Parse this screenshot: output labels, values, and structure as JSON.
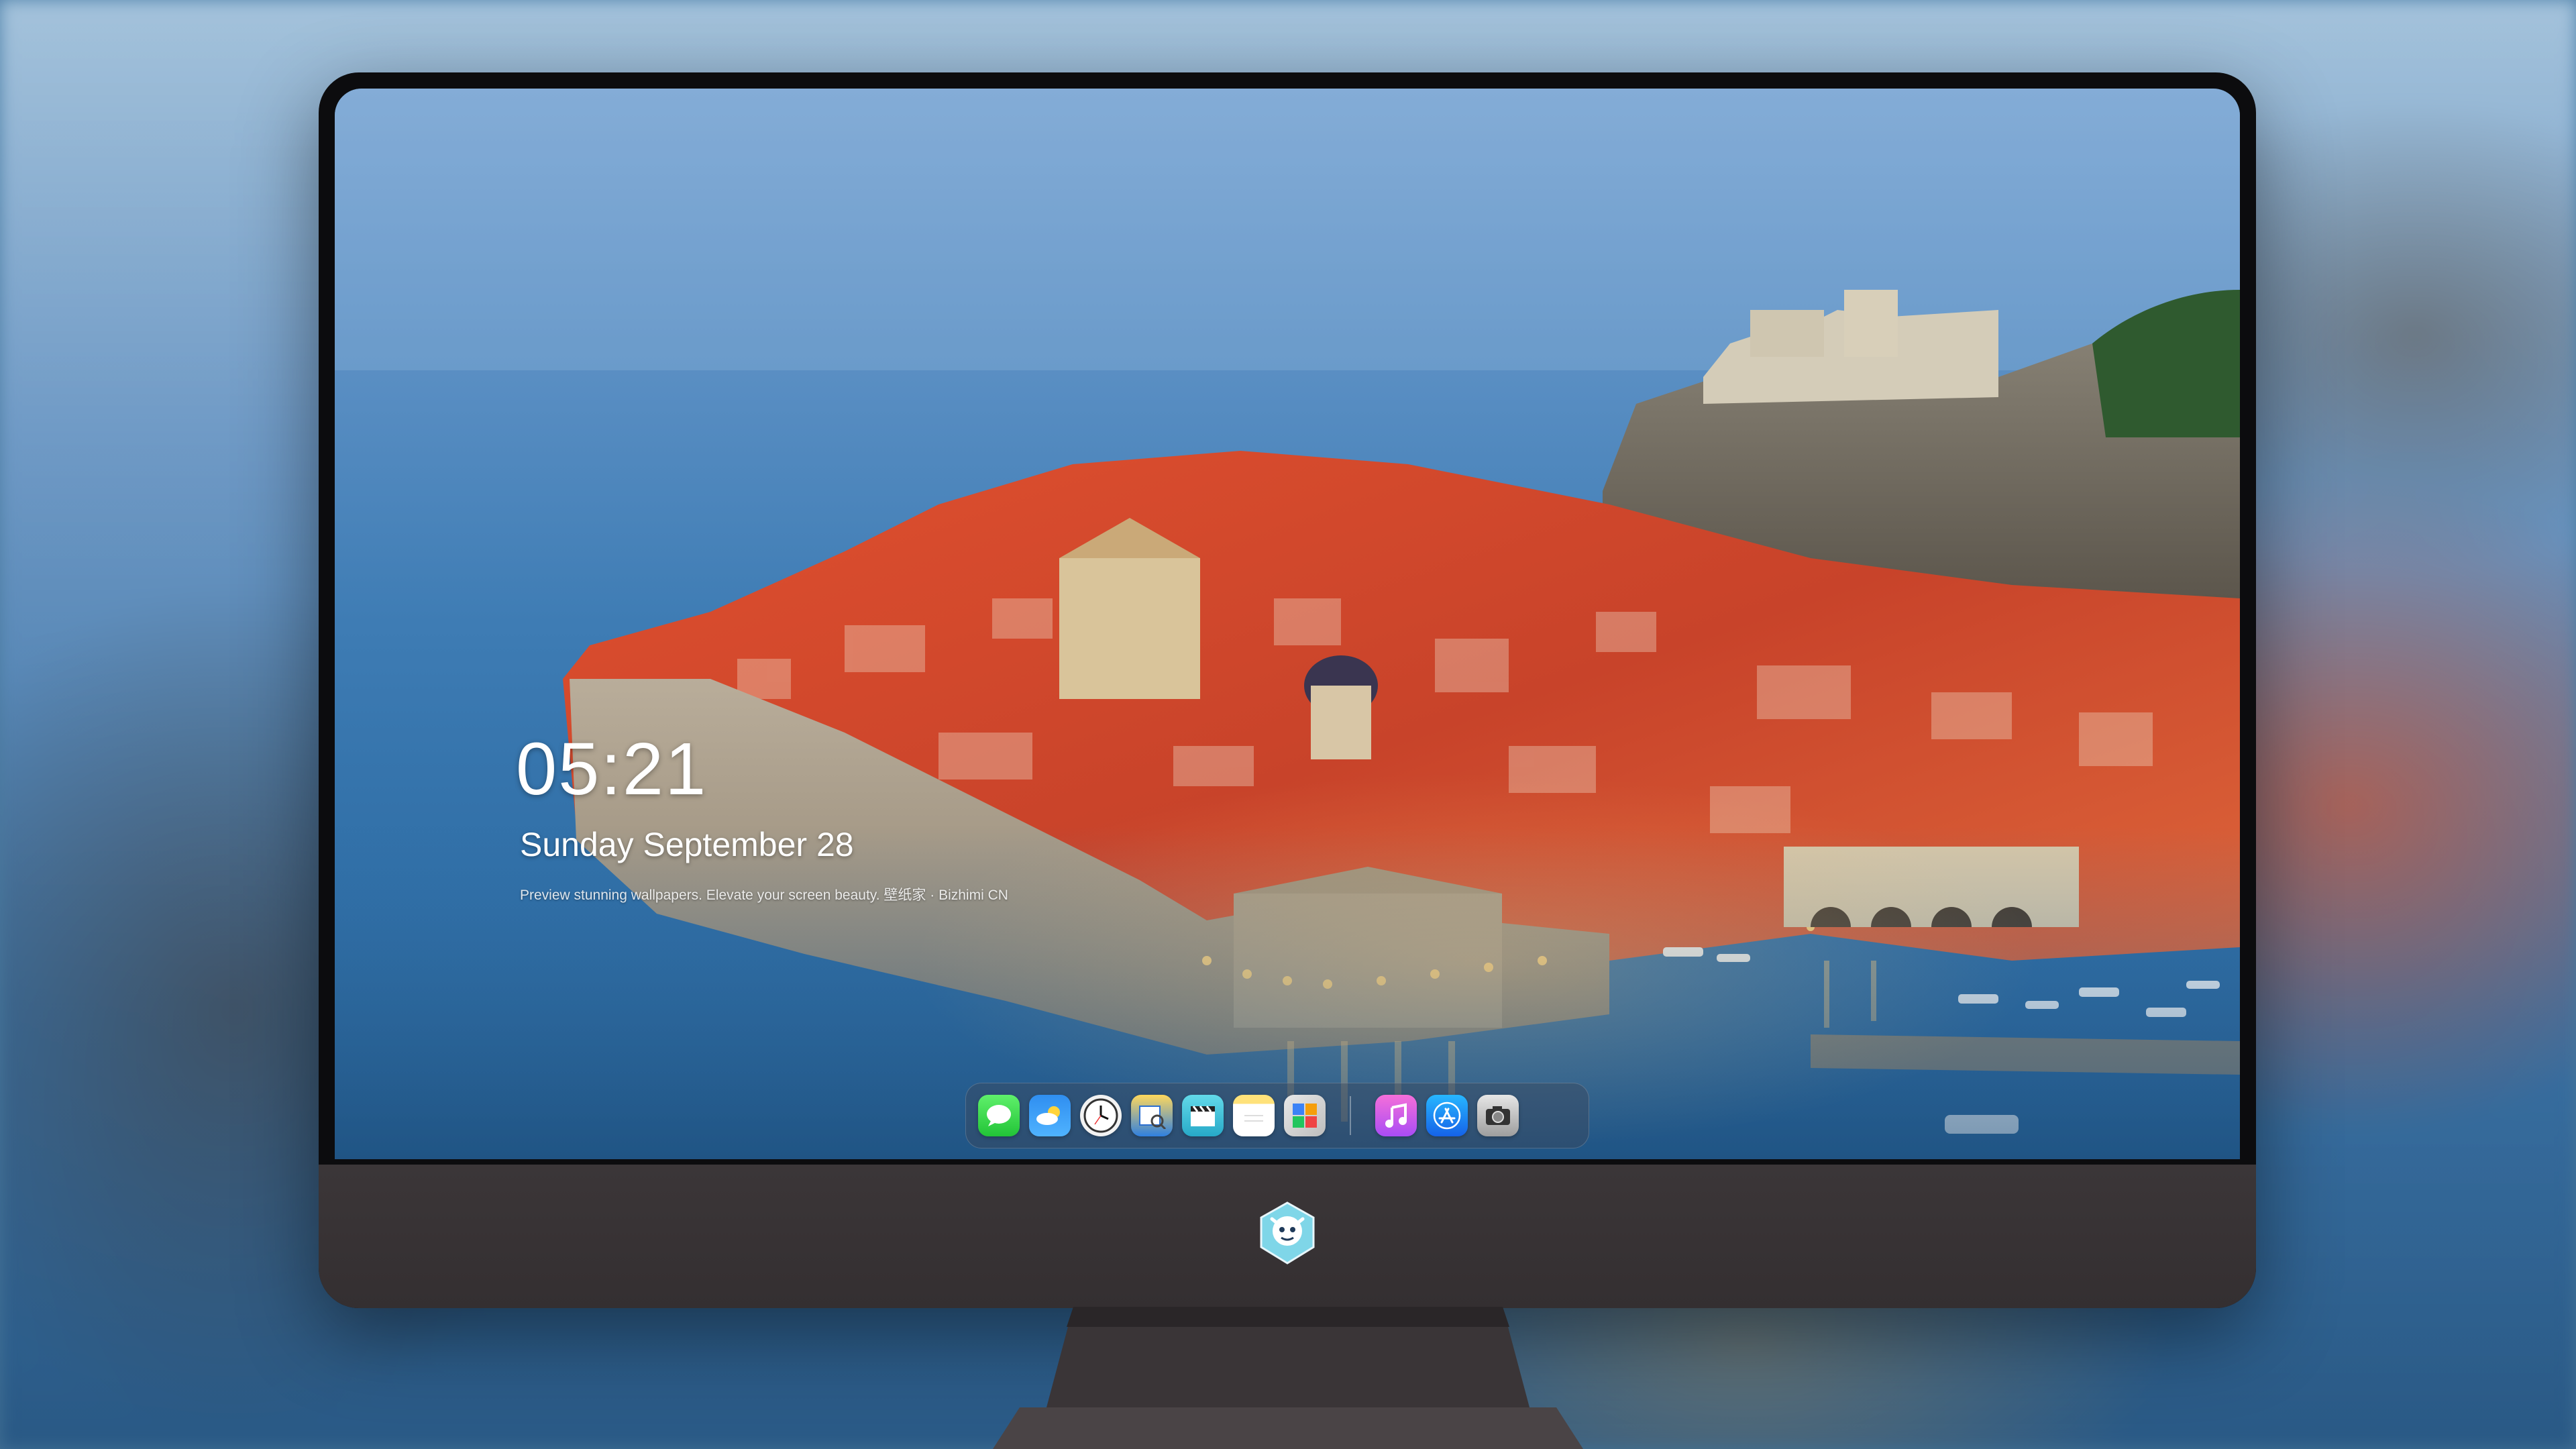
{
  "lock_screen": {
    "time": "05:21",
    "date": "Sunday September  28",
    "tagline": "Preview stunning wallpapers. Elevate your screen beauty. 壁纸家 · Bizhimi CN"
  },
  "dock": {
    "apps": [
      {
        "name": "Messages",
        "icon": "speech-bubble-icon",
        "color": "#34C759"
      },
      {
        "name": "Weather",
        "icon": "cloud-sun-icon",
        "color": "#3A8DF0"
      },
      {
        "name": "Clock",
        "icon": "clock-icon",
        "color": "#F2F2F2"
      },
      {
        "name": "Preview",
        "icon": "preview-icon",
        "color": "#FFD85C"
      },
      {
        "name": "Clips",
        "icon": "clapperboard-icon",
        "color": "#3FC6DE"
      },
      {
        "name": "Notes",
        "icon": "notes-icon",
        "color": "#FFE27A"
      },
      {
        "name": "Photo Booth",
        "icon": "photo-grid-icon",
        "color": "#D0D0D0"
      },
      {
        "name": "Music",
        "icon": "music-note-icon",
        "color": "#E55BE0"
      },
      {
        "name": "App Store",
        "icon": "app-store-icon",
        "color": "#1E8BFF"
      },
      {
        "name": "Camera",
        "icon": "camera-icon",
        "color": "#BDBDBD"
      }
    ]
  },
  "monitor": {
    "bezel_color": "#0C0C0E",
    "chin_color": "#3A3537",
    "logo_icon": "mascot-logo-icon"
  }
}
